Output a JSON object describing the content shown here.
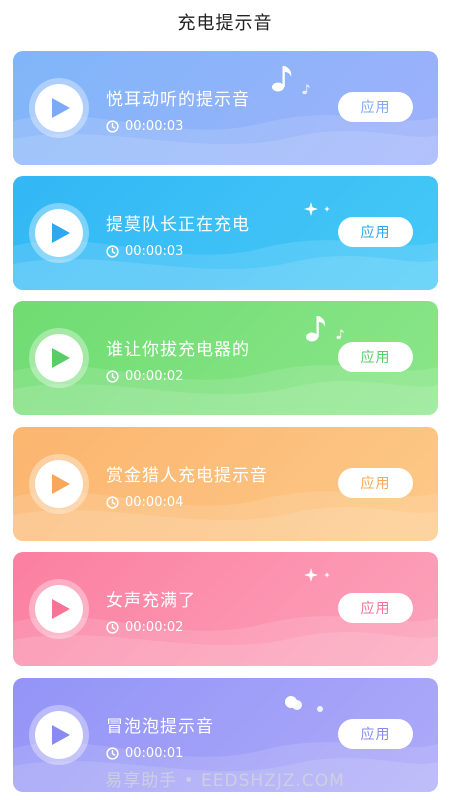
{
  "header": {
    "title": "充电提示音"
  },
  "cards": [
    {
      "title": "悦耳动听的提示音",
      "duration": "00:00:03",
      "apply_label": "应用",
      "colors": {
        "from": "#7fb6f9",
        "to": "#9fb0fb",
        "accent": "#7eaaf5"
      },
      "deco": "music-note-icon"
    },
    {
      "title": "提莫队长正在充电",
      "duration": "00:00:03",
      "apply_label": "应用",
      "colors": {
        "from": "#33b7f5",
        "to": "#45c9f7",
        "accent": "#2ea8ef"
      },
      "deco": "sparkle-icon"
    },
    {
      "title": "谁让你拔充电器的",
      "duration": "00:00:02",
      "apply_label": "应用",
      "colors": {
        "from": "#6fdc71",
        "to": "#8be68a",
        "accent": "#5bcd66"
      },
      "deco": "music-note-icon"
    },
    {
      "title": "赏金猎人充电提示音",
      "duration": "00:00:04",
      "apply_label": "应用",
      "colors": {
        "from": "#fbb56f",
        "to": "#fdc987",
        "accent": "#f8a85c"
      },
      "deco": "none"
    },
    {
      "title": "女声充满了",
      "duration": "00:00:02",
      "apply_label": "应用",
      "colors": {
        "from": "#fb7fa1",
        "to": "#fca3bb",
        "accent": "#f77496"
      },
      "deco": "sparkle-icon"
    },
    {
      "title": "冒泡泡提示音",
      "duration": "00:00:01",
      "apply_label": "应用",
      "colors": {
        "from": "#9394f7",
        "to": "#adaaf9",
        "accent": "#8a8bf2"
      },
      "deco": "bubbles-icon"
    }
  ],
  "watermark": "易享助手 • EEDSHZJZ.COM"
}
